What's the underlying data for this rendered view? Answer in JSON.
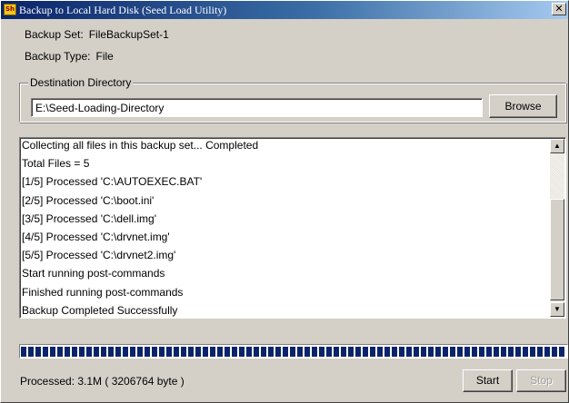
{
  "window": {
    "title": "Backup to Local Hard Disk (Seed Load Utility)",
    "icon": "seed-load-app-icon",
    "icon_glyph": "Sh",
    "close_glyph": "✕"
  },
  "info": {
    "backup_set_label": "Backup Set:",
    "backup_set_value": "FileBackupSet-1",
    "backup_type_label": "Backup Type:",
    "backup_type_value": "File"
  },
  "destination": {
    "group_label": "Destination Directory",
    "path_value": "E:\\Seed-Loading-Directory",
    "browse_label": "Browse"
  },
  "log": {
    "lines": [
      "Collecting all files in this backup set... Completed",
      "Total Files = 5",
      "[1/5] Processed 'C:\\AUTOEXEC.BAT'",
      "[2/5] Processed 'C:\\boot.ini'",
      "[3/5] Processed 'C:\\dell.img'",
      "[4/5] Processed 'C:\\drvnet.img'",
      "[5/5] Processed 'C:\\drvnet2.img'",
      "Start running post-commands",
      "Finished running post-commands",
      "Backup Completed Successfully"
    ],
    "scroll_up_glyph": "▲",
    "scroll_down_glyph": "▼"
  },
  "progress": {
    "fraction": 1.0,
    "color": "#0a246a"
  },
  "status": {
    "processed_text": "Processed: 3.1M ( 3206764 byte )"
  },
  "actions": {
    "start_label": "Start",
    "stop_label": "Stop",
    "stop_enabled": false
  }
}
